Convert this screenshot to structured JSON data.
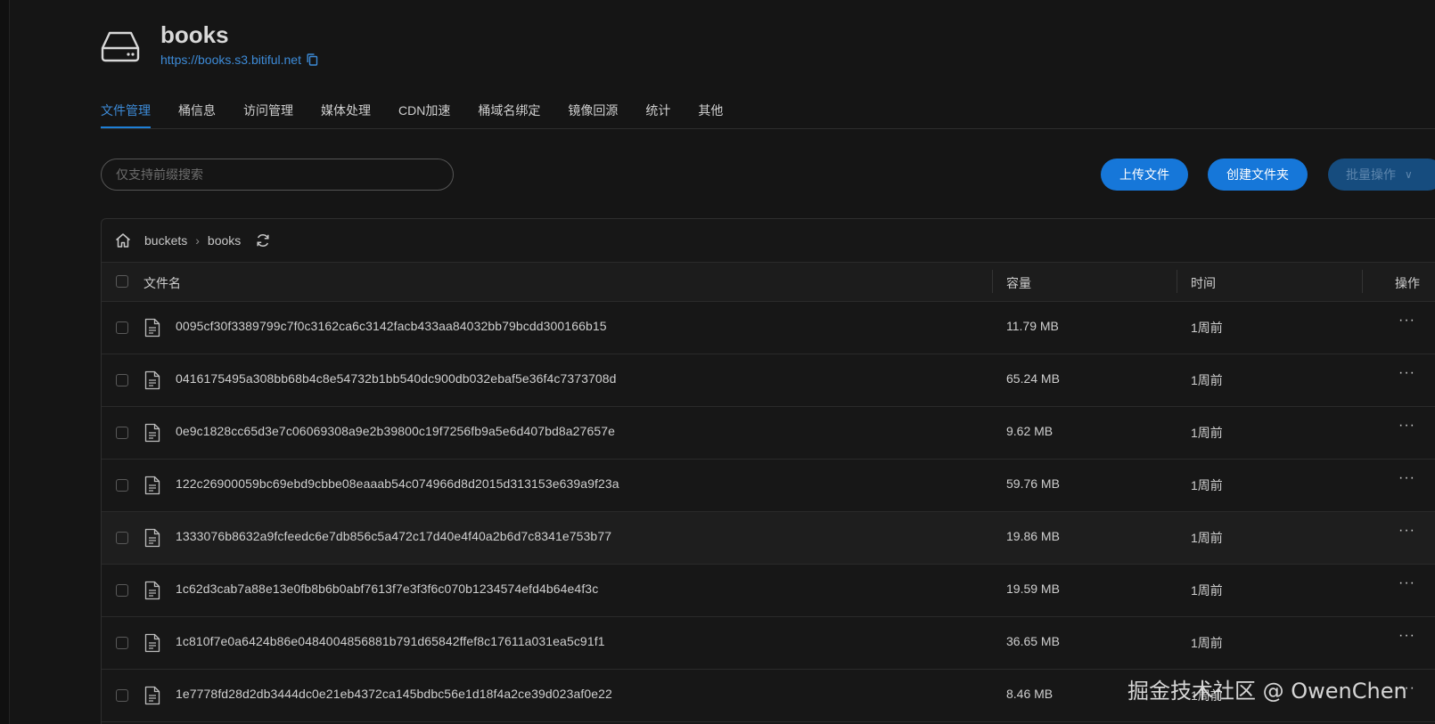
{
  "header": {
    "bucket_name": "books",
    "bucket_url": "https://books.s3.bitiful.net",
    "bucket_icon": "hard-drive-icon",
    "copy_icon": "copy-icon"
  },
  "tabs": [
    {
      "label": "文件管理",
      "active": true
    },
    {
      "label": "桶信息"
    },
    {
      "label": "访问管理"
    },
    {
      "label": "媒体处理"
    },
    {
      "label": "CDN加速"
    },
    {
      "label": "桶域名绑定"
    },
    {
      "label": "镜像回源"
    },
    {
      "label": "统计"
    },
    {
      "label": "其他"
    }
  ],
  "search": {
    "placeholder": "仅支持前缀搜索"
  },
  "toolbar": {
    "upload_label": "上传文件",
    "mkdir_label": "创建文件夹",
    "batch_label": "批量操作",
    "batch_chevron": "∨"
  },
  "breadcrumb": {
    "home_icon": "home-icon",
    "items": [
      "buckets",
      "books"
    ],
    "separator": "›",
    "refresh_icon": "refresh-icon"
  },
  "table": {
    "headers": {
      "name": "文件名",
      "size": "容量",
      "time": "时间",
      "actions": "操作"
    },
    "rows": [
      {
        "name": "0095cf30f3389799c7f0c3162ca6c3142facb433aa84032bb79bcdd300166b15",
        "size": "11.79 MB",
        "time": "1周前",
        "more": "···"
      },
      {
        "name": "0416175495a308bb68b4c8e54732b1bb540dc900db032ebaf5e36f4c7373708d",
        "size": "65.24 MB",
        "time": "1周前",
        "more": "···"
      },
      {
        "name": "0e9c1828cc65d3e7c06069308a9e2b39800c19f7256fb9a5e6d407bd8a27657e",
        "size": "9.62 MB",
        "time": "1周前",
        "more": "···"
      },
      {
        "name": "122c26900059bc69ebd9cbbe08eaaab54c074966d8d2015d313153e639a9f23a",
        "size": "59.76 MB",
        "time": "1周前",
        "more": "···"
      },
      {
        "name": "1333076b8632a9fcfeedc6e7db856c5a472c17d40e4f40a2b6d7c8341e753b77",
        "size": "19.86 MB",
        "time": "1周前",
        "more": "···"
      },
      {
        "name": "1c62d3cab7a88e13e0fb8b6b0abf7613f7e3f3f6c070b1234574efd4b64e4f3c",
        "size": "19.59 MB",
        "time": "1周前",
        "more": "···"
      },
      {
        "name": "1c810f7e0a6424b86e0484004856881b791d65842ffef8c17611a031ea5c91f1",
        "size": "36.65 MB",
        "time": "1周前",
        "more": "···"
      },
      {
        "name": "1e7778fd28d2db3444dc0e21eb4372ca145bdbc56e1d18f4a2ce39d023af0e22",
        "size": "8.46 MB",
        "time": "1周前",
        "more": "···"
      }
    ],
    "row_icon": "file-icon"
  },
  "watermark": "掘金技术社区 @ OwenChen"
}
